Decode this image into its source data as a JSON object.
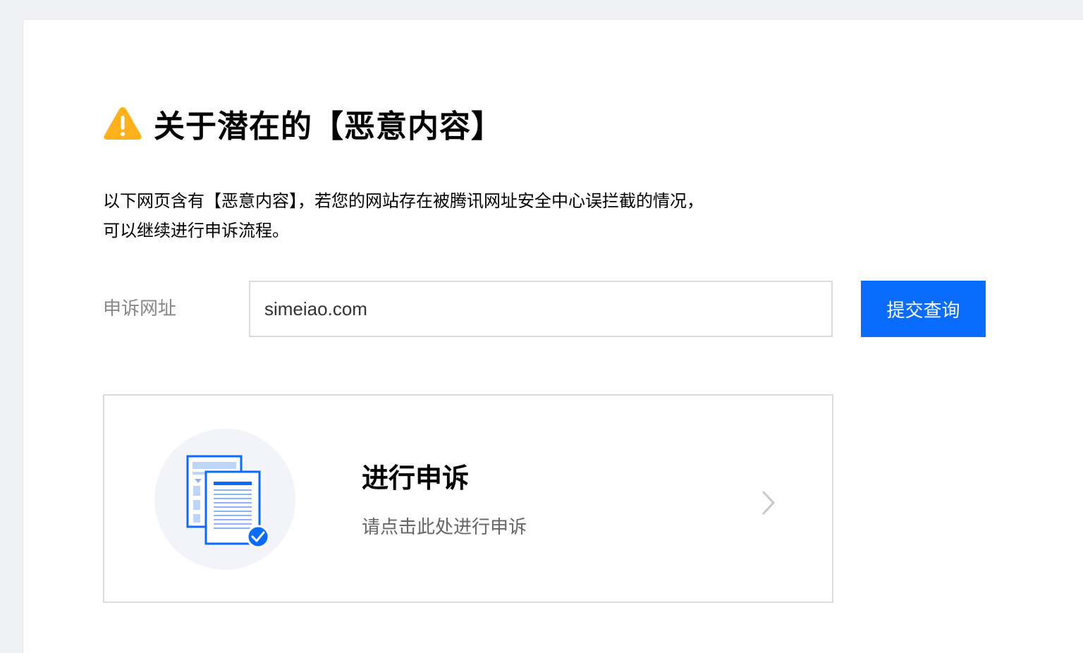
{
  "header": {
    "title": "关于潜在的【恶意内容】"
  },
  "description": {
    "line1": "以下网页含有【恶意内容】，若您的网站存在被腾讯网址安全中心误拦截的情况，",
    "line2": "可以继续进行申诉流程。"
  },
  "form": {
    "label": "申诉网址",
    "url_value": "simeiao.com",
    "submit_label": "提交查询"
  },
  "appeal_card": {
    "title": "进行申诉",
    "subtitle": "请点击此处进行申诉"
  },
  "colors": {
    "accent": "#0a6cff",
    "warning": "#ffb11b",
    "page_background": "#eff0f4",
    "illustration_background": "#f2f4f9"
  },
  "icons": {
    "warning": "warning-triangle-icon",
    "document": "document-check-icon",
    "chevron": "chevron-right-icon"
  }
}
